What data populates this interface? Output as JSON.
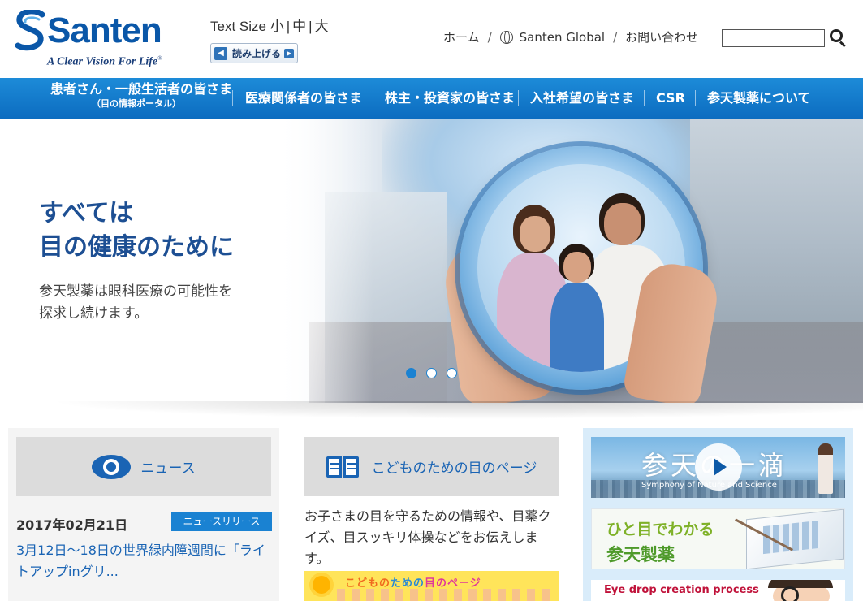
{
  "header": {
    "logo_word": "Santen",
    "logo_tagline": "A Clear Vision For Life",
    "logo_tm": "®",
    "text_size_label": "Text Size",
    "text_size_options": [
      "小",
      "中",
      "大"
    ],
    "read_aloud_label": "読み上げる",
    "util_links": {
      "home": "ホーム",
      "global": "Santen Global",
      "contact": "お問い合わせ"
    },
    "search": {
      "value": "",
      "placeholder": ""
    }
  },
  "nav": {
    "patients": "患者さん・一般生活者の皆さま",
    "patients_sub": "（目の情報ポータル）",
    "medical": "医療関係者の皆さま",
    "investors": "株主・投資家の皆さま",
    "recruit": "入社希望の皆さま",
    "csr": "CSR",
    "about": "参天製薬について"
  },
  "hero": {
    "title_line1": "すべては",
    "title_line2": "目の健康のために",
    "sub_line1": "参天製薬は眼科医療の可能性を",
    "sub_line2": "探求し続けます。",
    "slide_count": 3,
    "active_slide": 1
  },
  "news": {
    "heading": "ニュース",
    "date": "2017年02月21日",
    "badge": "ニュースリリース",
    "text": "3月12日～18日の世界緑内障週間に「ライトアップinグリ..."
  },
  "kids": {
    "heading": "こどものための目のページ",
    "text": "お子さまの目を守るための情報や、目薬クイズ、目スッキリ体操などをお伝えします。",
    "banner_part1": "こどもの",
    "banner_part2": "ための",
    "banner_part3": "目のページ"
  },
  "side_banners": {
    "drop_title": "参天の一滴",
    "drop_sub": "Symphony of Nature and Science",
    "overview_line1": "ひと目でわかる",
    "overview_line2": "参天製薬",
    "eyedrop_process": "Eye drop creation process"
  },
  "colors": {
    "brand_blue": "#0a57a8",
    "nav_blue": "#1a82d2",
    "link_blue": "#1a64b4",
    "green": "#7eb127",
    "red": "#c0123a"
  }
}
